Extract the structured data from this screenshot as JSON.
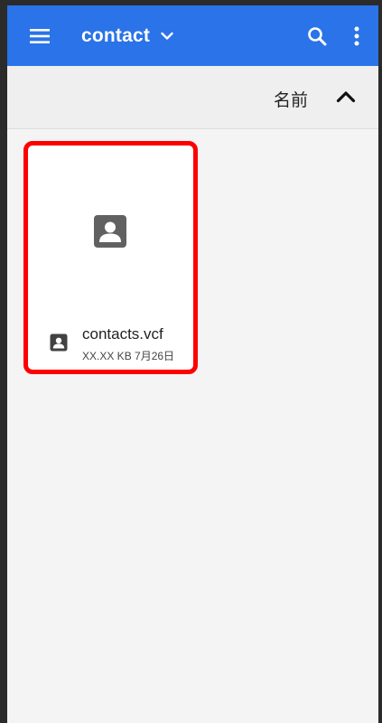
{
  "app_bar": {
    "title": "contact",
    "color": "#2a73e8",
    "icons": {
      "menu": "menu-icon",
      "dropdown": "chevron-down-icon",
      "search": "search-icon",
      "more": "more-vert-icon"
    }
  },
  "sort_bar": {
    "label": "名前",
    "direction_icon": "chevron-up-icon"
  },
  "files": [
    {
      "name": "contacts.vcf",
      "details": "XX.XX KB 7月26日",
      "icon": "contact-card-icon",
      "highlight_color": "#ff0000"
    }
  ]
}
